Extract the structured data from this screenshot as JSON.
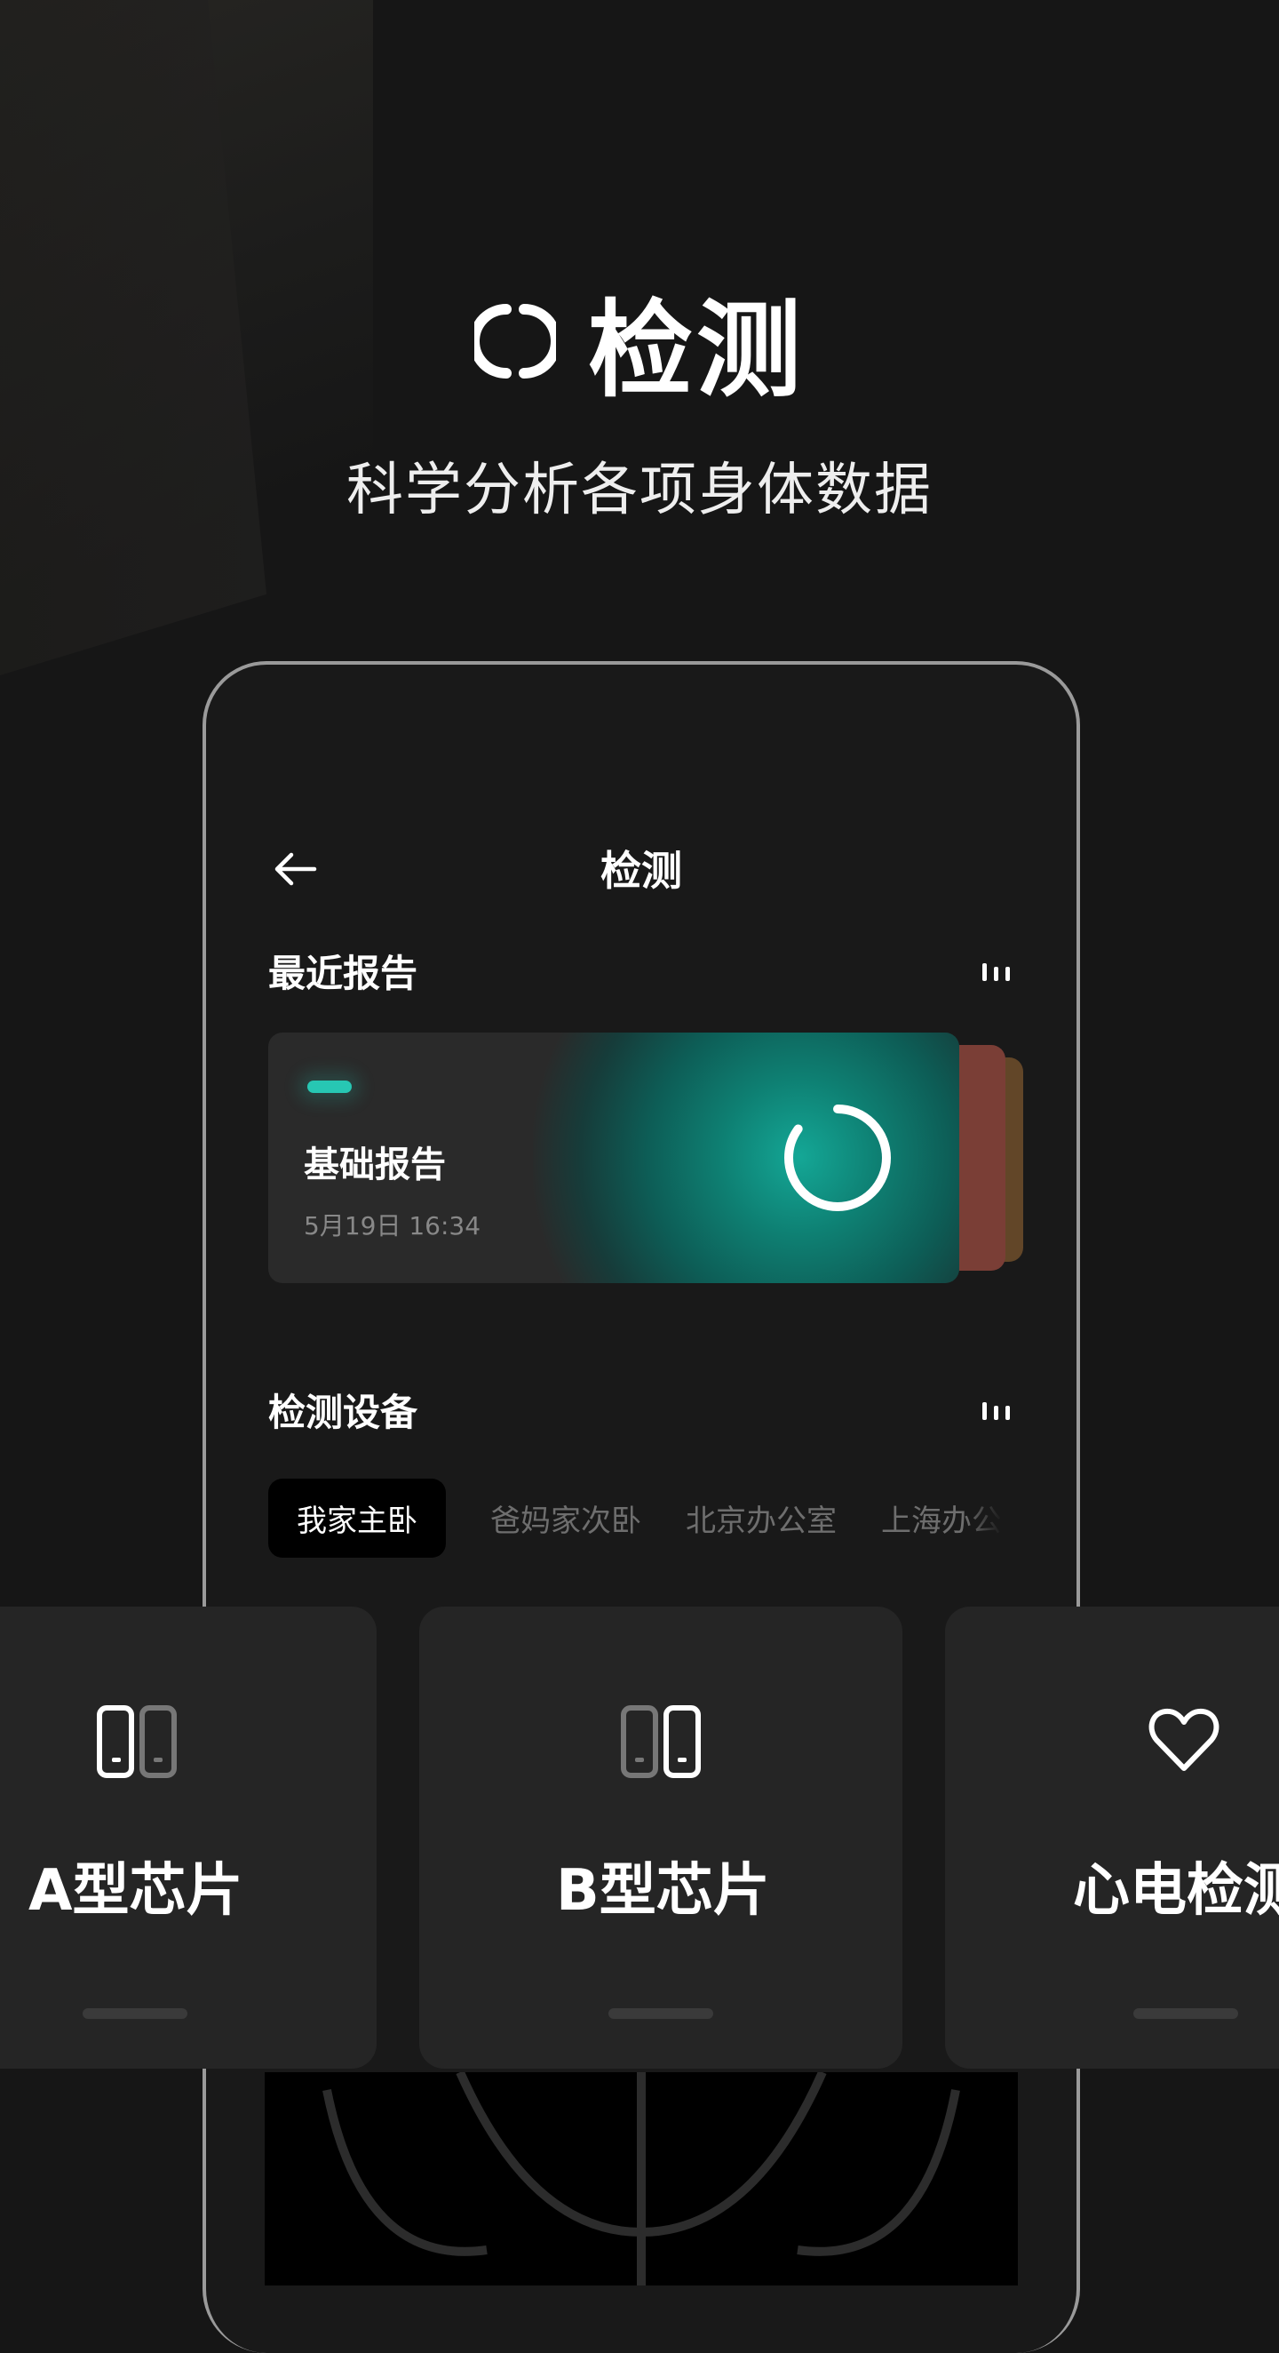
{
  "hero": {
    "title": "检测",
    "icon": "detect-icon",
    "subtitle": "科学分析各项身体数据"
  },
  "phone": {
    "nav": {
      "back_icon": "back-arrow-icon",
      "title": "检测"
    },
    "recent": {
      "section_title": "最近报告",
      "more_icon": "more-icon",
      "card": {
        "status_color": "#27c7b3",
        "title": "基础报告",
        "time": "5月19日 16:34",
        "ring_icon": "progress-ring-icon",
        "progress": 0.85
      }
    },
    "devices": {
      "section_title": "检测设备",
      "more_icon": "more-icon",
      "chips": [
        "我家主卧",
        "爸妈家次卧",
        "北京办公室",
        "上海办公"
      ],
      "active_index": 0
    }
  },
  "features": [
    {
      "label": "A型芯片",
      "icon": "chip-a-icon"
    },
    {
      "label": "B型芯片",
      "icon": "chip-b-icon"
    },
    {
      "label": "心电检测",
      "icon": "heart-icon"
    }
  ],
  "colors": {
    "accent": "#27c7b3",
    "background": "#161616",
    "card": "#252525"
  }
}
